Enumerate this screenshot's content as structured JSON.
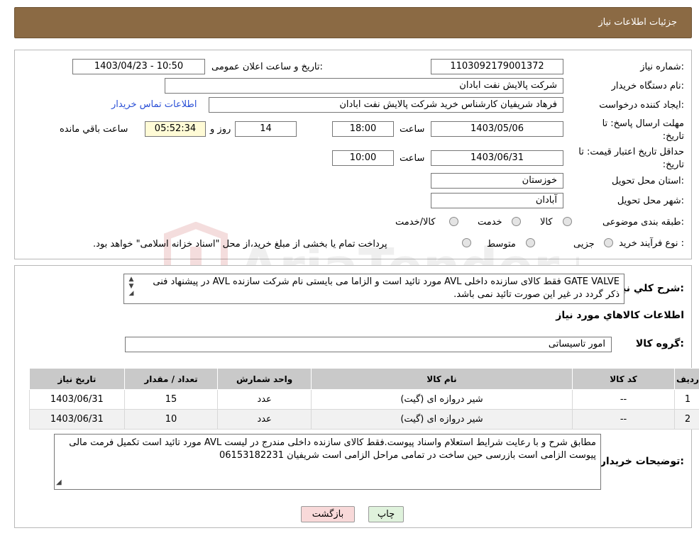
{
  "header": {
    "title": "جزئیات اطلاعات نیاز"
  },
  "fields": {
    "need_number_label": "شماره نیاز:",
    "need_number": "1103092179001372",
    "announce_label": "تاریخ و ساعت اعلان عمومی:",
    "announce_value": "1403/04/23 - 10:50",
    "buyer_org_label": "نام دستگاه خریدار:",
    "buyer_org": "شرکت پالایش نفت ابادان",
    "creator_label": "ایجاد کننده درخواست:",
    "creator": "فرهاد شریفیان کارشناس خرید شرکت پالایش نفت ابادان",
    "contact_link": "اطلاعات تماس خریدار",
    "deadline_label": "مهلت ارسال پاسخ: تا تاریخ:",
    "deadline_date": "1403/05/06",
    "time_label": "ساعت",
    "deadline_time": "18:00",
    "days_value": "14",
    "days_label": "روز و",
    "remaining_time": "05:52:34",
    "remaining_label": "ساعت باقي مانده",
    "validity_label": "حداقل تاریخ اعتبار قیمت: تا تاریخ:",
    "validity_date": "1403/06/31",
    "validity_time": "10:00",
    "province_label": "استان محل تحویل:",
    "province": "خوزستان",
    "city_label": "شهر محل تحویل:",
    "city": "آبادان",
    "category_label": "طبقه بندی موضوعی:",
    "category_options": [
      "کالا",
      "خدمت",
      "کالا/خدمت"
    ],
    "process_label": "نوع فرآیند خرید :",
    "process_options": [
      "جزیی",
      "متوسط"
    ],
    "payment_note": "پرداخت تمام یا بخشی از مبلغ خرید،از محل \"اسناد خزانه اسلامی\" خواهد بود."
  },
  "watermark": {
    "text": "AriaTender.neT"
  },
  "description": {
    "label": "شرح کلي نياز:",
    "text": "GATE VALVE فقط کالای سازنده داخلی AVL مورد تائید است و الزاما می بایستی نام شرکت سازنده AVL در پیشنهاد فنی ذکر گردد در غیر این صورت تائید نمی باشد."
  },
  "goods": {
    "section_title": "اطلاعات کالاهاي مورد نياز",
    "group_label": "گروه کالا:",
    "group_value": "امور تاسیساتی",
    "columns": [
      "ردیف",
      "کد کالا",
      "نام کالا",
      "واحد شمارش",
      "تعداد / مقدار",
      "تاریخ نیاز"
    ],
    "rows": [
      {
        "row": "1",
        "code": "--",
        "name": "شیر دروازه ای (گیت)",
        "unit": "عدد",
        "qty": "15",
        "date": "1403/06/31"
      },
      {
        "row": "2",
        "code": "--",
        "name": "شیر دروازه ای (گیت)",
        "unit": "عدد",
        "qty": "10",
        "date": "1403/06/31"
      }
    ]
  },
  "notes": {
    "label": "توضیحات خریدار:",
    "text": "مطابق شرح و با رعایت شرایط استعلام واسناد پیوست.فقط کالای سازنده داخلی مندرج در لیست AVL مورد تائید است تکمیل فرمت مالی پیوست الزامی است بازرسی حین ساخت در تمامی مراحل الزامی  است شریفیان 06153182231"
  },
  "buttons": {
    "back": "بازگشت",
    "print": "چاپ"
  }
}
